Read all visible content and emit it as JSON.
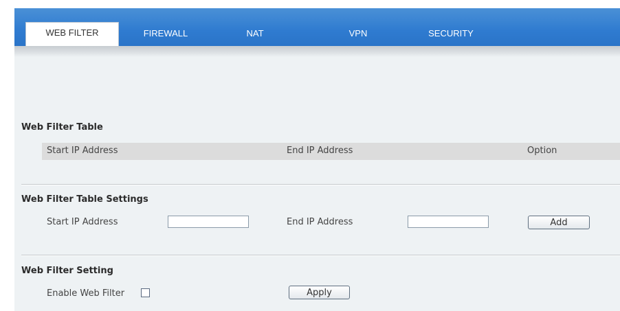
{
  "tabs": [
    {
      "label": "WEB FILTER",
      "active": true
    },
    {
      "label": "FIREWALL",
      "active": false
    },
    {
      "label": "NAT",
      "active": false
    },
    {
      "label": "VPN",
      "active": false
    },
    {
      "label": "SECURITY",
      "active": false
    }
  ],
  "web_filter_table": {
    "title": "Web Filter Table",
    "columns": [
      "Start IP Address",
      "End IP Address",
      "Option"
    ],
    "rows": []
  },
  "table_settings": {
    "title": "Web Filter Table Settings",
    "start_label": "Start IP Address",
    "start_value": "",
    "end_label": "End IP Address",
    "end_value": "",
    "add_label": "Add"
  },
  "filter_setting": {
    "title": "Web Filter Setting",
    "enable_label": "Enable Web Filter",
    "enabled": false,
    "apply_label": "Apply"
  },
  "colors": {
    "tabbar": "#2f7bd0",
    "panel": "#eef2f4",
    "header_row": "#dcdcdc"
  }
}
